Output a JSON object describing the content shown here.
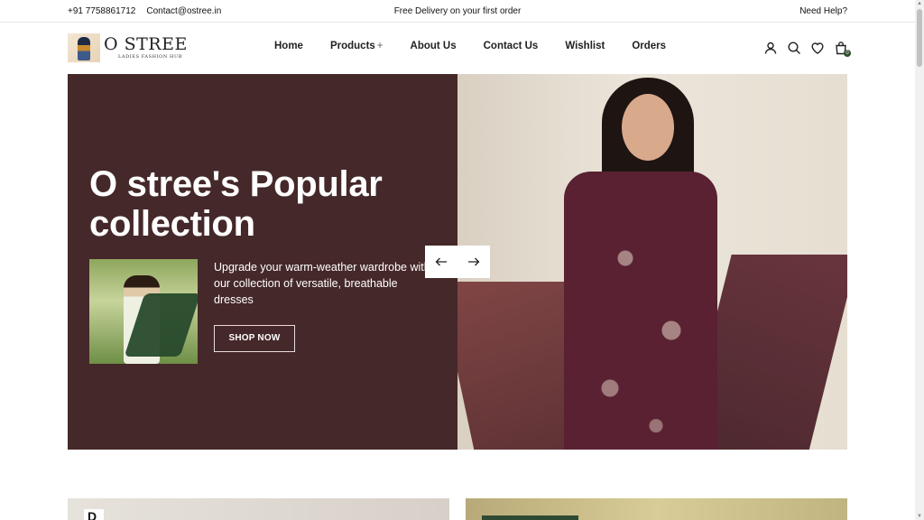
{
  "topbar": {
    "phone": "+91 7758861712",
    "email": "Contact@ostree.in",
    "promo": "Free Delivery on your first order",
    "help": "Need Help?"
  },
  "logo": {
    "brand": "O STREE",
    "tagline": "LADIES FASHION HUB"
  },
  "nav": [
    {
      "label": "Home"
    },
    {
      "label": "Products",
      "suffix": "+"
    },
    {
      "label": "About Us"
    },
    {
      "label": "Contact Us"
    },
    {
      "label": "Wishlist"
    },
    {
      "label": "Orders"
    }
  ],
  "header_icons": [
    "user-icon",
    "search-icon",
    "heart-icon",
    "bag-icon"
  ],
  "cart_count": "0",
  "hero": {
    "title": "O stree's Popular collection",
    "description": "Upgrade your warm-weather wardrobe with our collection of versatile, breathable dresses",
    "button": "SHOP NOW",
    "bg_color": "#452829"
  },
  "lower_cards": {
    "left_mark": "D"
  },
  "colors": {
    "accent": "#452829",
    "badge": "#2f4f2f"
  }
}
